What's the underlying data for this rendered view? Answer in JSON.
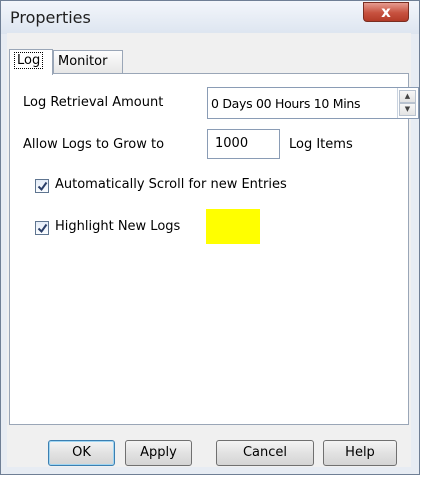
{
  "window": {
    "title": "Properties",
    "close_glyph": "x"
  },
  "tabs": [
    {
      "label": "Log",
      "active": true
    },
    {
      "label": "Monitor",
      "active": false
    }
  ],
  "log_tab": {
    "retrieval_label": "Log Retrieval Amount",
    "retrieval_value": "0 Days 00 Hours  10 Mins",
    "grow_label": "Allow Logs to Grow to",
    "grow_value": "1000",
    "grow_suffix": "Log Items",
    "auto_scroll": {
      "label": "Automatically Scroll for new Entries",
      "checked": true
    },
    "highlight": {
      "label": "Highlight New Logs",
      "checked": true,
      "color": "#ffff00"
    }
  },
  "buttons": {
    "ok": "OK",
    "apply": "Apply",
    "cancel": "Cancel",
    "help": "Help"
  }
}
